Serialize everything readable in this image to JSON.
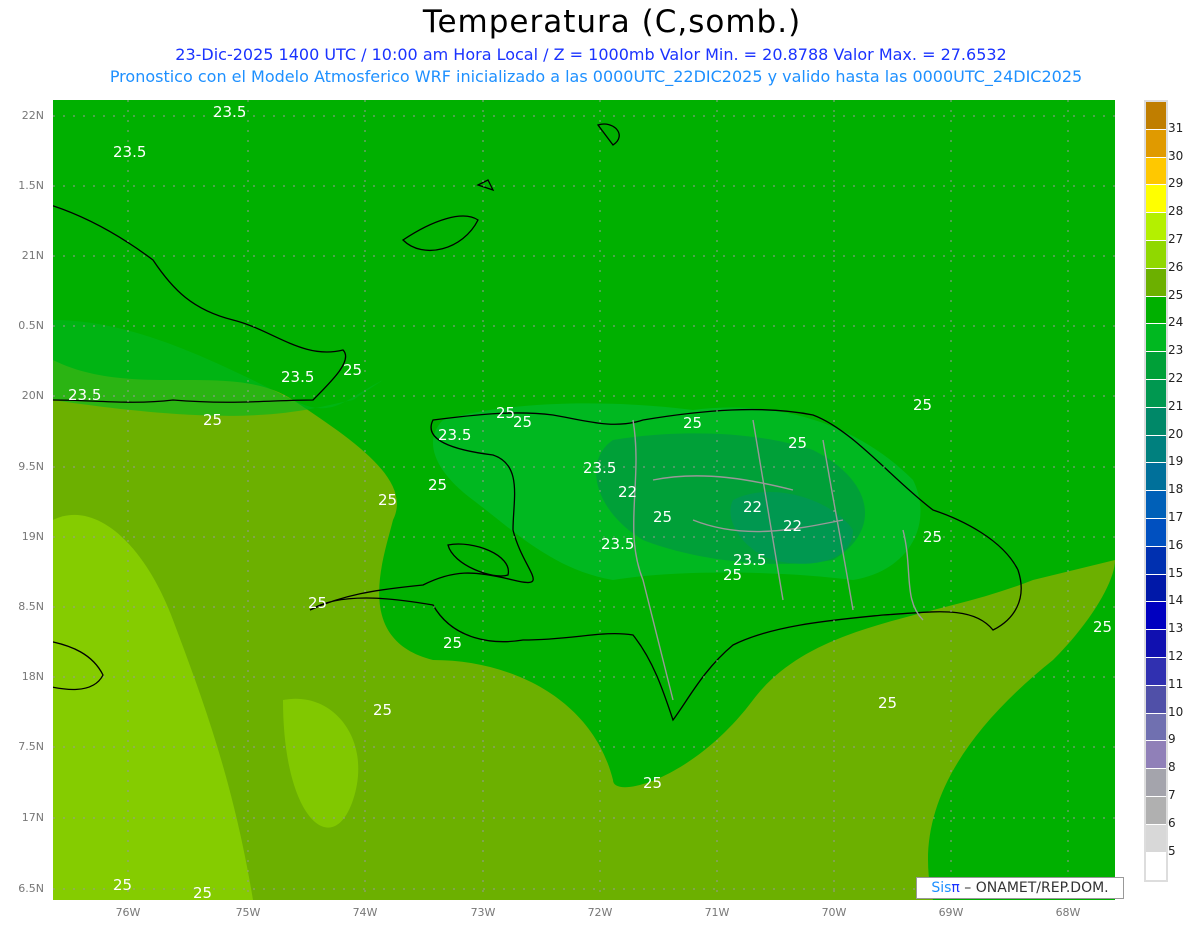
{
  "header": {
    "title": "Temperatura (C,somb.)",
    "line1": "23-Dic-2025 1400 UTC / 10:00 am Hora Local / Z = 1000mb   Valor Min. = 20.8788   Valor Max. = 27.6532",
    "line2": "Pronostico con el Modelo Atmosferico WRF inicializado a las 0000UTC_22DIC2025 y valido hasta las  0000UTC_24DIC2025"
  },
  "axes": {
    "lat_labels": [
      "22N",
      "1.5N",
      "21N",
      "0.5N",
      "20N",
      "9.5N",
      "19N",
      "8.5N",
      "18N",
      "7.5N",
      "17N",
      "6.5N"
    ],
    "lon_labels": [
      "76W",
      "75W",
      "74W",
      "73W",
      "72W",
      "71W",
      "70W",
      "69W",
      "68W"
    ]
  },
  "colorbar": {
    "labels": [
      "31",
      "30",
      "29",
      "28",
      "27",
      "26",
      "25",
      "24",
      "23",
      "22",
      "21",
      "20",
      "19",
      "18",
      "17",
      "16",
      "15",
      "14",
      "13",
      "12",
      "11",
      "10",
      "9",
      "8",
      "7",
      "6",
      "5"
    ],
    "colors": [
      "#c07e00",
      "#e09a00",
      "#ffc800",
      "#ffff00",
      "#b4f000",
      "#90d800",
      "#6cb000",
      "#00b000",
      "#00b820",
      "#00a038",
      "#009850",
      "#008868",
      "#00807e",
      "#00709a",
      "#0060b8",
      "#0050c0",
      "#0030b0",
      "#0018a8",
      "#0000c0",
      "#1010b0",
      "#3030b0",
      "#5050a8",
      "#7070b0",
      "#9080b8",
      "#a4a4ac",
      "#b0b0b0",
      "#d8d8d8",
      "#ffffff"
    ]
  },
  "contour_labels": [
    "23.5",
    "23.5",
    "23.5",
    "23.5",
    "25",
    "25",
    "25",
    "25",
    "23.5",
    "25",
    "25",
    "25",
    "23.5",
    "22",
    "25",
    "22",
    "22",
    "23.5",
    "25",
    "23.5",
    "25",
    "25",
    "25",
    "25",
    "25",
    "25",
    "25",
    "25",
    "25",
    "25",
    "25"
  ],
  "credit": {
    "brand": "Sis",
    "pi": "π",
    "org": " –  ONAMET/REP.DOM."
  }
}
